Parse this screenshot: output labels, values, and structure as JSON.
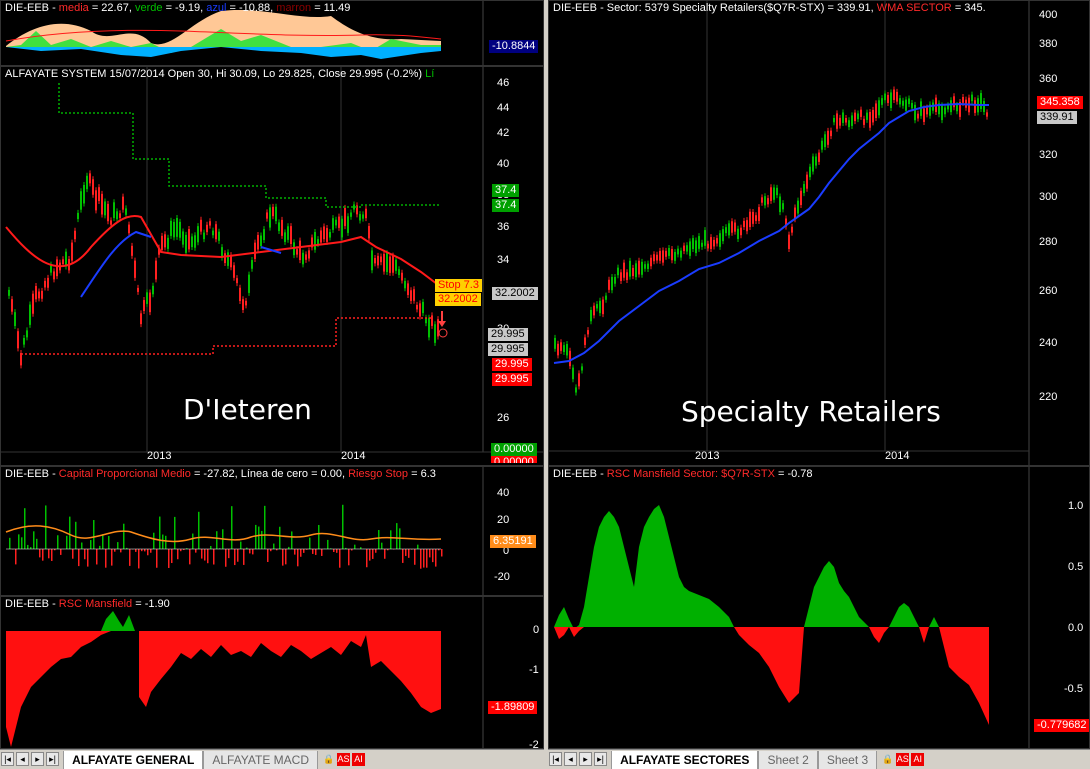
{
  "left": {
    "pane1": {
      "ticker": "DIE-EEB",
      "lbl1": "media",
      "val1": "= 22.67,",
      "lbl2": "verde",
      "val2": "= -9.19,",
      "lbl3": "azul",
      "val3": "= -10.88,",
      "lbl4": "marron",
      "val4": "= 11.49",
      "tag": "-10.8844"
    },
    "pane2": {
      "header": "ALFAYATE SYSTEM 15/07/2014 Open 30, Hi 30.09, Lo 29.825, Close 29.995 (-0.2%)",
      "header_tail": "Lí",
      "yticks": [
        "46",
        "44",
        "42",
        "40",
        "38",
        "36",
        "34",
        "32",
        "30",
        "28",
        "26"
      ],
      "xticks": [
        "2013",
        "2014"
      ],
      "tags": {
        "green1": "37.4",
        "green2": "37.4",
        "stop1": "Stop 7.3",
        "stop2": "32.2002",
        "gray1": "32.2002",
        "gray2": "29.995",
        "gray3": "29.995",
        "red1": "29.995",
        "red2": "29.995",
        "green3": "0.00000",
        "red3": "0.00000"
      },
      "caption": "D'Ieteren"
    },
    "pane3": {
      "ticker": "DIE-EEB",
      "lbl1": "Capital Proporcional Medio",
      "val1": "= -27.82,",
      "lbl2": "Línea de cero",
      "val2": "= 0.00,",
      "lbl3": "Riesgo Stop",
      "val3": "= 6.3",
      "yticks": [
        "40",
        "20",
        "0",
        "-20"
      ],
      "tag": "6.35191"
    },
    "pane4": {
      "ticker": "DIE-EEB",
      "lbl1": "RSC Mansfield",
      "val1": "= -1.90",
      "yticks": [
        "0",
        "-1",
        "-2"
      ],
      "tag": "-1.89809"
    },
    "tabs": {
      "t1": "ALFAYATE GENERAL",
      "t2": "ALFAYATE MACD",
      "mini1": "AS",
      "mini2": "AI"
    }
  },
  "right": {
    "pane1": {
      "ticker": "DIE-EEB",
      "lbl1": "Sector: 5379 Specialty Retailers($Q7R-STX)",
      "val1": "= 339.91,",
      "lbl2": "WMA SECTOR",
      "val2": "= 345.",
      "yticks": [
        "400",
        "380",
        "360",
        "340",
        "320",
        "300",
        "280",
        "260",
        "240",
        "220"
      ],
      "xticks": [
        "2013",
        "2014"
      ],
      "tags": {
        "red": "345.358",
        "gray": "339.91"
      },
      "caption": "Specialty Retailers"
    },
    "pane2": {
      "ticker": "DIE-EEB",
      "lbl1": "RSC Mansfield Sector: $Q7R-STX",
      "val1": "= -0.78",
      "yticks": [
        "1.0",
        "0.5",
        "0.0",
        "-0.5"
      ],
      "tag": "-0.779682"
    },
    "tabs": {
      "t1": "ALFAYATE SECTORES",
      "t2": "Sheet 2",
      "t3": "Sheet 3",
      "mini1": "AS",
      "mini2": "AI"
    }
  },
  "colors": {
    "up": "#00c000",
    "down": "#ff2020",
    "wma": "#1a3cff",
    "avg": "#ff1a1a",
    "stop_green": "#00b000",
    "stop_red": "#ff2020",
    "orange": "#ff8c1a",
    "peach": "#ffc896"
  }
}
